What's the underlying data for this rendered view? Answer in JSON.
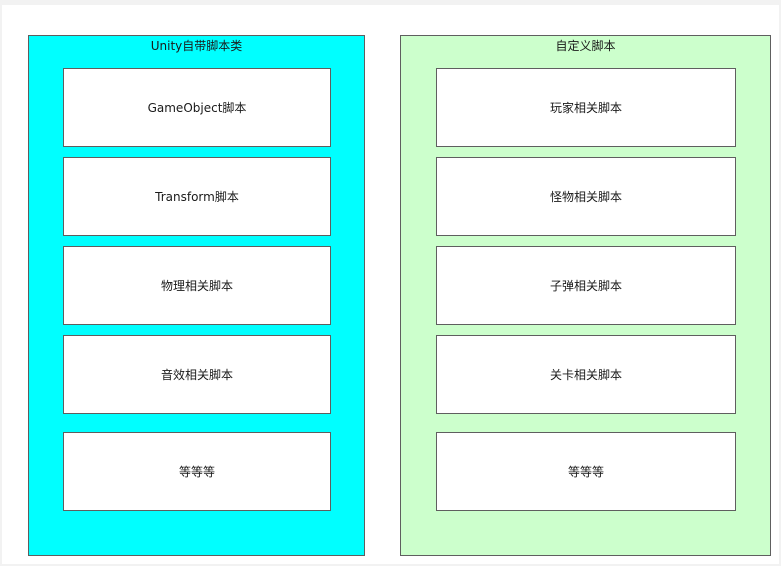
{
  "colors": {
    "left_group_fill": "#00ffff",
    "right_group_fill": "#ccffcc",
    "box_fill": "#ffffff",
    "border": "#5f5f5f",
    "text": "#1a1a1a"
  },
  "left_group": {
    "title": "Unity自带脚本类",
    "items": [
      {
        "label": "GameObject脚本"
      },
      {
        "label": "Transform脚本"
      },
      {
        "label": "物理相关脚本"
      },
      {
        "label": "音效相关脚本"
      },
      {
        "label": "等等等"
      }
    ]
  },
  "right_group": {
    "title": "自定义脚本",
    "items": [
      {
        "label": "玩家相关脚本"
      },
      {
        "label": "怪物相关脚本"
      },
      {
        "label": "子弹相关脚本"
      },
      {
        "label": "关卡相关脚本"
      },
      {
        "label": "等等等"
      }
    ]
  }
}
